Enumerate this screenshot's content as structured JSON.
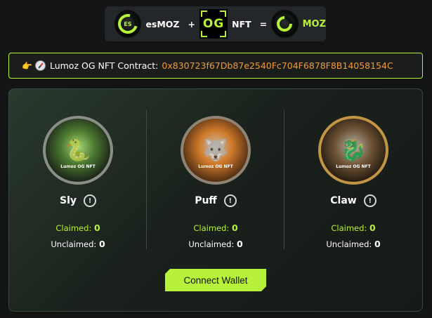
{
  "formula": {
    "coin1_label": "ES",
    "token1": "esMOZ",
    "plus": "+",
    "og_label": "OG",
    "nft": "NFT",
    "equals": "=",
    "result": "MOZ"
  },
  "contract": {
    "emoji_hand": "👉",
    "label": "Lumoz OG NFT Contract:",
    "address": "0x830723f67Db87e2540Fc704F6878F8B14058154C"
  },
  "nfts": [
    {
      "name": "Sly",
      "claimed_label": "Claimed:",
      "claimed": "0",
      "unclaimed_label": "Unclaimed:",
      "unclaimed": "0",
      "medal_text": "Lumoz OG NFT"
    },
    {
      "name": "Puff",
      "claimed_label": "Claimed:",
      "claimed": "0",
      "unclaimed_label": "Unclaimed:",
      "unclaimed": "0",
      "medal_text": "Lumoz OG NFT"
    },
    {
      "name": "Claw",
      "claimed_label": "Claimed:",
      "claimed": "0",
      "unclaimed_label": "Unclaimed:",
      "unclaimed": "0",
      "medal_text": "Lumoz OG NFT"
    }
  ],
  "info_glyph": "!",
  "connect_button": "Connect Wallet",
  "colors": {
    "accent": "#b7f13c",
    "address": "#f19a3b",
    "background": "#131514"
  },
  "icons": {
    "es_coin": "esmoz-coin-icon",
    "og_badge": "og-badge-icon",
    "moz_coin": "moz-coin-icon",
    "info": "info-icon"
  }
}
